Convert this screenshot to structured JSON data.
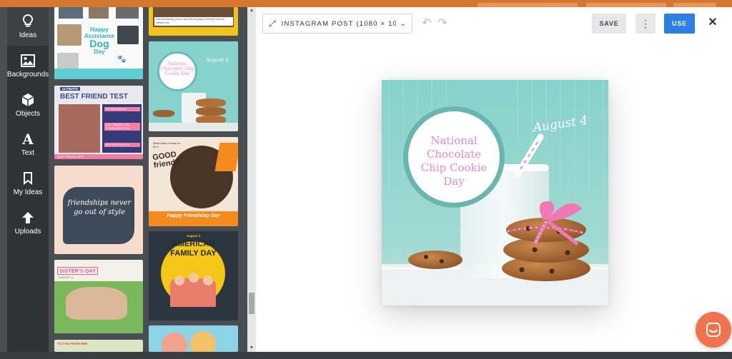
{
  "nav": {
    "items": [
      {
        "label": "Ideas",
        "icon": "lightbulb-icon"
      },
      {
        "label": "Backgrounds",
        "icon": "image-icon"
      },
      {
        "label": "Objects",
        "icon": "cube-icon"
      },
      {
        "label": "Text",
        "icon": "text-a-icon"
      },
      {
        "label": "My Ideas",
        "icon": "bookmark-icon"
      },
      {
        "label": "Uploads",
        "icon": "upload-arrow-icon"
      }
    ],
    "active": "Ideas"
  },
  "templates": {
    "dog_day": {
      "line1": "Happy",
      "line2": "Assistance",
      "line3": "Dog",
      "line4": "Day"
    },
    "science_note": "It is scientifically proven that the company of friends reduces stress in life.",
    "cookie_thumb": {
      "title": "National Chocolate Chip Cookie Day",
      "date": "August 4"
    },
    "best_friend": {
      "badge": "ULTIMATE",
      "title": "BEST FRIEND TEST",
      "items": [
        "THE BEGINNING",
        "JUST PASSED THE SEVEN-YEAR ITCH",
        "BESTIES FOR LIFE"
      ],
      "footer": "BEST FRIEND TEST"
    },
    "good_friend": {
      "question": "What does it mean to be a",
      "title": "GOOD friend?",
      "footer": "Happy Friendship Day"
    },
    "friendships": {
      "quote": "friendships never go out of style"
    },
    "family_day": {
      "date": "August 4",
      "title": "AMERICAN FAMILY DAY"
    },
    "sisters_day": {
      "title": "SISTER'S DAY",
      "date": "AUGUST 4"
    },
    "last_thumb": {
      "label": "TO YOU FROM HER"
    }
  },
  "toolbar": {
    "size_label": "INSTAGRAM POST (1080 × 10...",
    "save_label": "SAVE",
    "use_label": "USE",
    "close_label": "✕"
  },
  "design": {
    "title": "National Chocolate Chip Cookie Day",
    "date": "August 4",
    "colors": {
      "teal": "#7ccfc8",
      "pink": "#e58bc8",
      "cookie": "#b0703a"
    }
  },
  "colors": {
    "accent": "#2d7fe6",
    "chat": "#f0734d",
    "sidebar": "#2f3236"
  }
}
